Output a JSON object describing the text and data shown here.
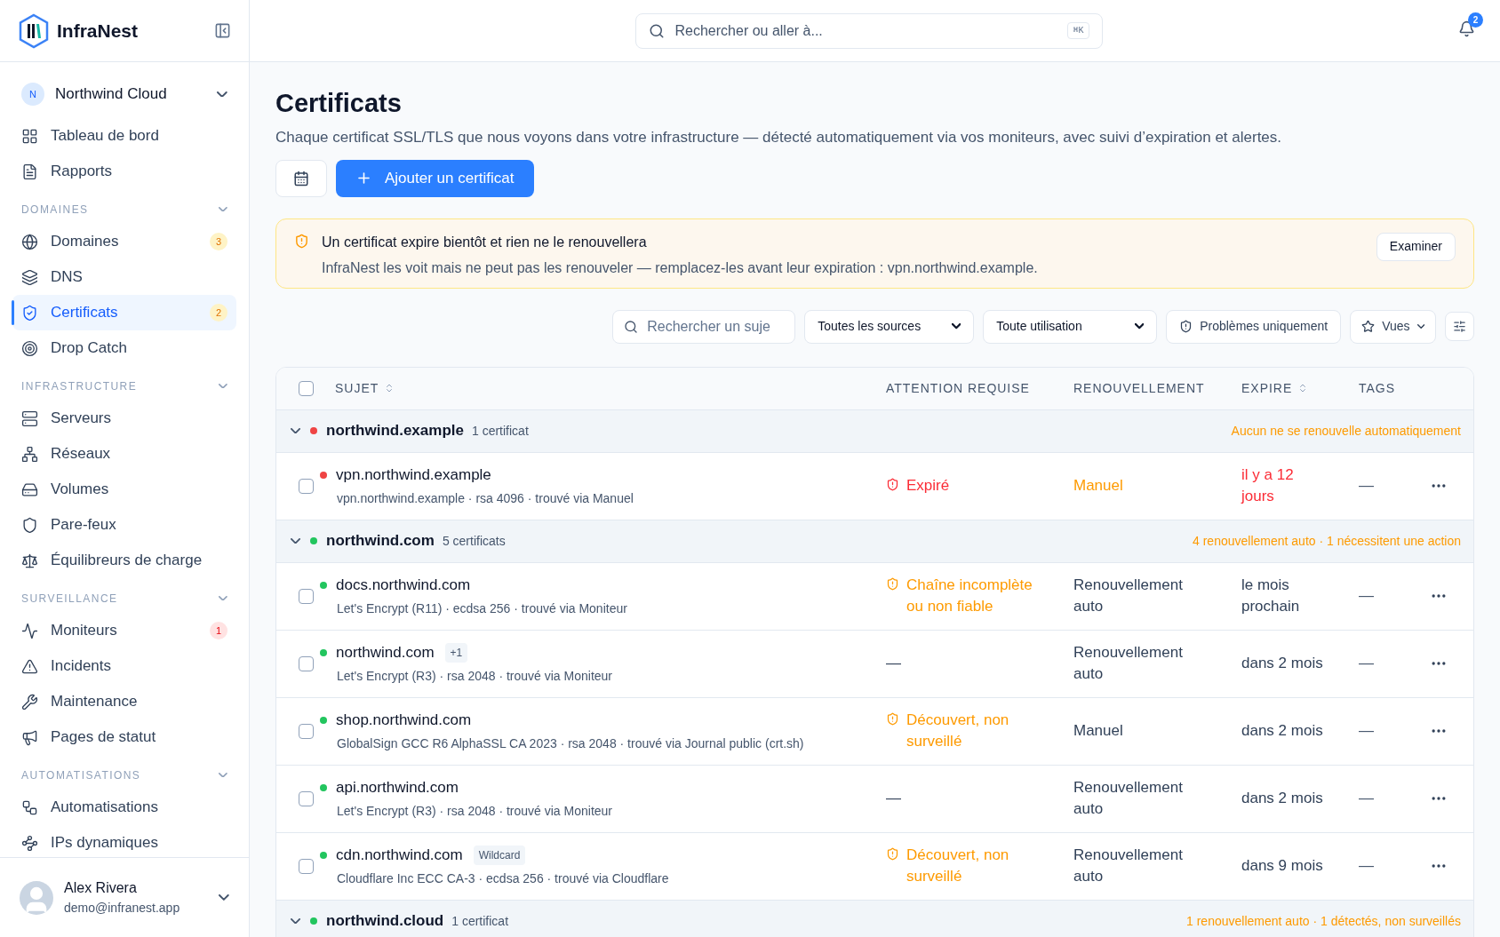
{
  "brand": {
    "name": "InfraNest"
  },
  "workspace": {
    "initial": "N",
    "name": "Northwind Cloud"
  },
  "sidebar": {
    "sections": [
      {
        "items": [
          {
            "label": "Tableau de bord",
            "selected": false
          },
          {
            "label": "Rapports",
            "selected": false
          }
        ]
      },
      {
        "title": "DOMAINES",
        "expanded": true,
        "items": [
          {
            "label": "Domaines",
            "selected": false,
            "badge": {
              "text": "3",
              "kind": "warning"
            }
          },
          {
            "label": "DNS",
            "selected": false
          },
          {
            "label": "Certificats",
            "selected": true,
            "badge": {
              "text": "2",
              "kind": "warning"
            }
          },
          {
            "label": "Drop Catch",
            "selected": false
          }
        ]
      },
      {
        "title": "INFRASTRUCTURE",
        "expanded": true,
        "items": [
          {
            "label": "Serveurs",
            "selected": false
          },
          {
            "label": "Réseaux",
            "selected": false
          },
          {
            "label": "Volumes",
            "selected": false
          },
          {
            "label": "Pare-feux",
            "selected": false
          },
          {
            "label": "Équilibreurs de charge",
            "selected": false
          }
        ]
      },
      {
        "title": "SURVEILLANCE",
        "expanded": true,
        "items": [
          {
            "label": "Moniteurs",
            "selected": false,
            "badge": {
              "text": "1",
              "kind": "danger"
            }
          },
          {
            "label": "Incidents",
            "selected": false
          },
          {
            "label": "Maintenance",
            "selected": false
          },
          {
            "label": "Pages de statut",
            "selected": false
          }
        ]
      },
      {
        "title": "AUTOMATISATIONS",
        "expanded": true,
        "items": [
          {
            "label": "Automatisations",
            "selected": false
          },
          {
            "label": "IPs dynamiques",
            "selected": false
          }
        ]
      }
    ]
  },
  "user": {
    "name": "Alex Rivera",
    "email": "demo@infranest.app"
  },
  "topbar": {
    "search_placeholder": "Rechercher ou aller à...",
    "shortcut": "⌘K",
    "notifications": "2"
  },
  "page": {
    "title": "Certificats",
    "description": "Chaque certificat SSL/TLS que nous voyons dans votre infrastructure — détecté automatiquement via vos moniteurs, avec suivi d’expiration et alertes.",
    "add_button": "Ajouter un certificat"
  },
  "alert": {
    "title": "Un certificat expire bientôt et rien ne le renouvellera",
    "text": "InfraNest les voit mais ne peut pas les renouveler — remplacez-les avant leur expiration : vpn.northwind.example.",
    "button": "Examiner"
  },
  "filters": {
    "search_placeholder": "Rechercher un suje",
    "source": "Toutes les sources",
    "usage": "Toute utilisation",
    "problems_button": "Problèmes uniquement",
    "views_button": "Vues"
  },
  "table": {
    "select_all": {
      "checked": false
    },
    "columns": [
      {
        "label": "SUJET",
        "sortable": true
      },
      {
        "label": "ATTENTION REQUISE",
        "sortable": false
      },
      {
        "label": "RENOUVELLEMENT",
        "sortable": false
      },
      {
        "label": "EXPIRE",
        "sortable": true
      },
      {
        "label": "TAGS",
        "sortable": false
      }
    ],
    "groups": [
      {
        "name": "northwind.example",
        "count": "1 certificat",
        "color": "#ef4444",
        "expanded": true,
        "summary": "Aucun ne se renouvelle automatiquement",
        "rows": [
          {
            "subject": "vpn.northwind.example",
            "color": "#ef4444",
            "details": "vpn.northwind.example · rsa 4096 · trouvé via Manuel",
            "checked": false,
            "attention": {
              "text": "Expiré",
              "kind": "danger"
            },
            "renewal": {
              "text": "Manuel",
              "kind": "warning"
            },
            "expires": {
              "text": "il y a 12 jours",
              "kind": "danger"
            },
            "tags": "—"
          }
        ]
      },
      {
        "name": "northwind.com",
        "count": "5 certificats",
        "color": "#22c55e",
        "expanded": true,
        "summary": "4 renouvellement auto · 1 nécessitent une action",
        "rows": [
          {
            "subject": "docs.northwind.com",
            "color": "#22c55e",
            "details": "Let's Encrypt (R11) · ecdsa 256 · trouvé via Moniteur",
            "checked": false,
            "attention": {
              "text": "Chaîne incomplète ou non fiable",
              "kind": "warning"
            },
            "renewal": {
              "text": "Renouvellement auto",
              "kind": "normal"
            },
            "expires": {
              "text": "le mois prochain",
              "kind": "normal"
            },
            "tags": "—"
          },
          {
            "subject": "northwind.com",
            "tag": "+1",
            "color": "#22c55e",
            "details": "Let's Encrypt (R3) · rsa 2048 · trouvé via Moniteur",
            "checked": false,
            "attention": {
              "text": "—",
              "kind": "none"
            },
            "renewal": {
              "text": "Renouvellement auto",
              "kind": "normal"
            },
            "expires": {
              "text": "dans 2 mois",
              "kind": "normal"
            },
            "tags": "—"
          },
          {
            "subject": "shop.northwind.com",
            "color": "#22c55e",
            "details": "GlobalSign GCC R6 AlphaSSL CA 2023 · rsa 2048 · trouvé via Journal public (crt.sh)",
            "checked": false,
            "attention": {
              "text": "Découvert, non surveillé",
              "kind": "warning"
            },
            "renewal": {
              "text": "Manuel",
              "kind": "normal"
            },
            "expires": {
              "text": "dans 2 mois",
              "kind": "normal"
            },
            "tags": "—"
          },
          {
            "subject": "api.northwind.com",
            "color": "#22c55e",
            "details": "Let's Encrypt (R3) · rsa 2048 · trouvé via Moniteur",
            "checked": false,
            "attention": {
              "text": "—",
              "kind": "none"
            },
            "renewal": {
              "text": "Renouvellement auto",
              "kind": "normal"
            },
            "expires": {
              "text": "dans 2 mois",
              "kind": "normal"
            },
            "tags": "—"
          },
          {
            "subject": "cdn.northwind.com",
            "tag": "Wildcard",
            "color": "#22c55e",
            "details": "Cloudflare Inc ECC CA-3 · ecdsa 256 · trouvé via Cloudflare",
            "checked": false,
            "attention": {
              "text": "Découvert, non surveillé",
              "kind": "warning"
            },
            "renewal": {
              "text": "Renouvellement auto",
              "kind": "normal"
            },
            "expires": {
              "text": "dans 9 mois",
              "kind": "normal"
            },
            "tags": "—"
          }
        ]
      },
      {
        "name": "northwind.cloud",
        "count": "1 certificat",
        "color": "#22c55e",
        "expanded": true,
        "summary": "1 renouvellement auto · 1 détectés, non surveillés"
      }
    ]
  }
}
